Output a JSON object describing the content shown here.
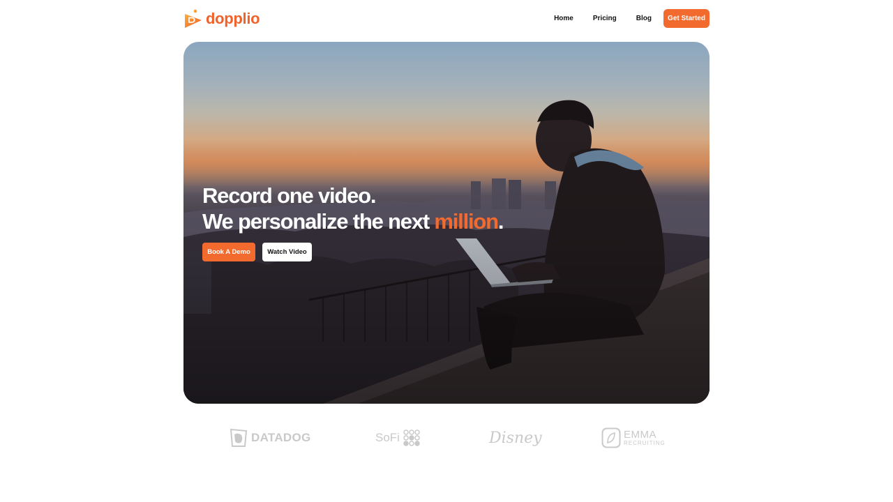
{
  "brand": {
    "name": "dopplio",
    "accent_color": "#f26a2e"
  },
  "nav": {
    "links": [
      {
        "label": "Home"
      },
      {
        "label": "Pricing"
      },
      {
        "label": "Blog"
      }
    ],
    "cta_label": "Get Started"
  },
  "hero": {
    "headline_line1": "Record one video.",
    "headline_line2_prefix": "We personalize the next ",
    "headline_line2_accent": "million",
    "headline_line2_suffix": ".",
    "primary_button": "Book A Demo",
    "secondary_button": "Watch Video",
    "background_image": "person-with-laptop-at-sunset-photo"
  },
  "client_logos": [
    {
      "name": "DATADOG",
      "icon": "datadog-dog-icon"
    },
    {
      "name": "SoFi",
      "icon": "sofi-dots-icon"
    },
    {
      "name": "Disney",
      "icon": "disney-wordmark"
    },
    {
      "name": "EMMA",
      "subtext": "RECRUITING",
      "icon": "emma-leaf-icon"
    }
  ]
}
